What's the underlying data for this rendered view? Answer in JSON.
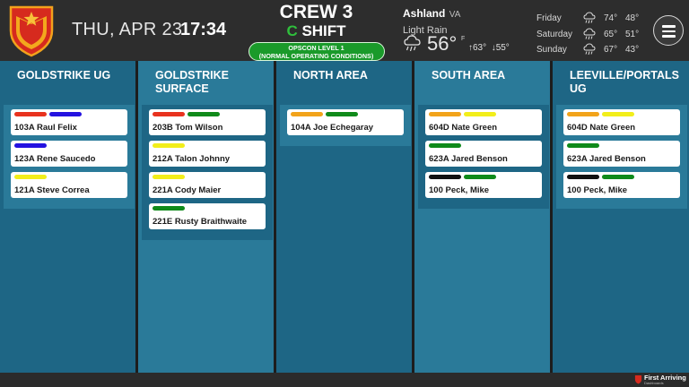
{
  "header": {
    "date": "THU, APR 23",
    "time": "17:34",
    "crew": "CREW 3",
    "shift_letter": "C",
    "shift_word": " SHIFT",
    "opscon_line1": "OPSCON LEVEL 1",
    "opscon_line2": "(NORMAL OPERATING CONDITIONS)"
  },
  "weather": {
    "city": "Ashland",
    "state": "VA",
    "condition": "Light Rain",
    "temp": "56°",
    "unit": "F",
    "high": "63°",
    "low": "55°",
    "icon": "rain-cloud-icon",
    "forecast": [
      {
        "day": "Friday",
        "icon": "rain-cloud-icon",
        "high": "74°",
        "low": "48°"
      },
      {
        "day": "Saturday",
        "icon": "rain-cloud-icon",
        "high": "65°",
        "low": "51°"
      },
      {
        "day": "Sunday",
        "icon": "rain-cloud-icon",
        "high": "67°",
        "low": "43°"
      }
    ]
  },
  "colors": {
    "red": "#e8321e",
    "blue": "#2412e0",
    "yellow": "#f2ee1a",
    "green": "#0f8a1a",
    "orange": "#f2a31a",
    "black": "#111111",
    "col_dark": "#1e6685",
    "col_light": "#2a7a99"
  },
  "columns": [
    {
      "title": "GOLDSTRIKE UG",
      "cards": [
        {
          "name": "103A Raul Felix",
          "tags": [
            "red",
            "blue"
          ]
        },
        {
          "name": "123A Rene Saucedo",
          "tags": [
            "blue"
          ]
        },
        {
          "name": "121A Steve Correa",
          "tags": [
            "yellow"
          ]
        }
      ]
    },
    {
      "title": "GOLDSTRIKE SURFACE",
      "cards": [
        {
          "name": "203B Tom Wilson",
          "tags": [
            "red",
            "green"
          ]
        },
        {
          "name": "212A Talon Johnny",
          "tags": [
            "yellow"
          ]
        },
        {
          "name": "221A Cody Maier",
          "tags": [
            "yellow"
          ]
        },
        {
          "name": "221E Rusty Braithwaite",
          "tags": [
            "green"
          ]
        }
      ]
    },
    {
      "title": "NORTH AREA",
      "cards": [
        {
          "name": "104A Joe Echegaray",
          "tags": [
            "orange",
            "green"
          ]
        }
      ]
    },
    {
      "title": "SOUTH AREA",
      "cards": [
        {
          "name": "604D Nate Green",
          "tags": [
            "orange",
            "yellow"
          ]
        },
        {
          "name": "623A Jared Benson",
          "tags": [
            "green"
          ]
        },
        {
          "name": "100 Peck, Mike",
          "tags": [
            "black",
            "green"
          ]
        }
      ]
    },
    {
      "title": "LEEVILLE/PORTALS UG",
      "cards": [
        {
          "name": "604D Nate Green",
          "tags": [
            "orange",
            "yellow"
          ]
        },
        {
          "name": "623A Jared Benson",
          "tags": [
            "green"
          ]
        },
        {
          "name": "100 Peck, Mike",
          "tags": [
            "black",
            "green"
          ]
        }
      ]
    }
  ],
  "footer": {
    "brand": "First Arriving",
    "brand_sub": "Dashboards"
  }
}
